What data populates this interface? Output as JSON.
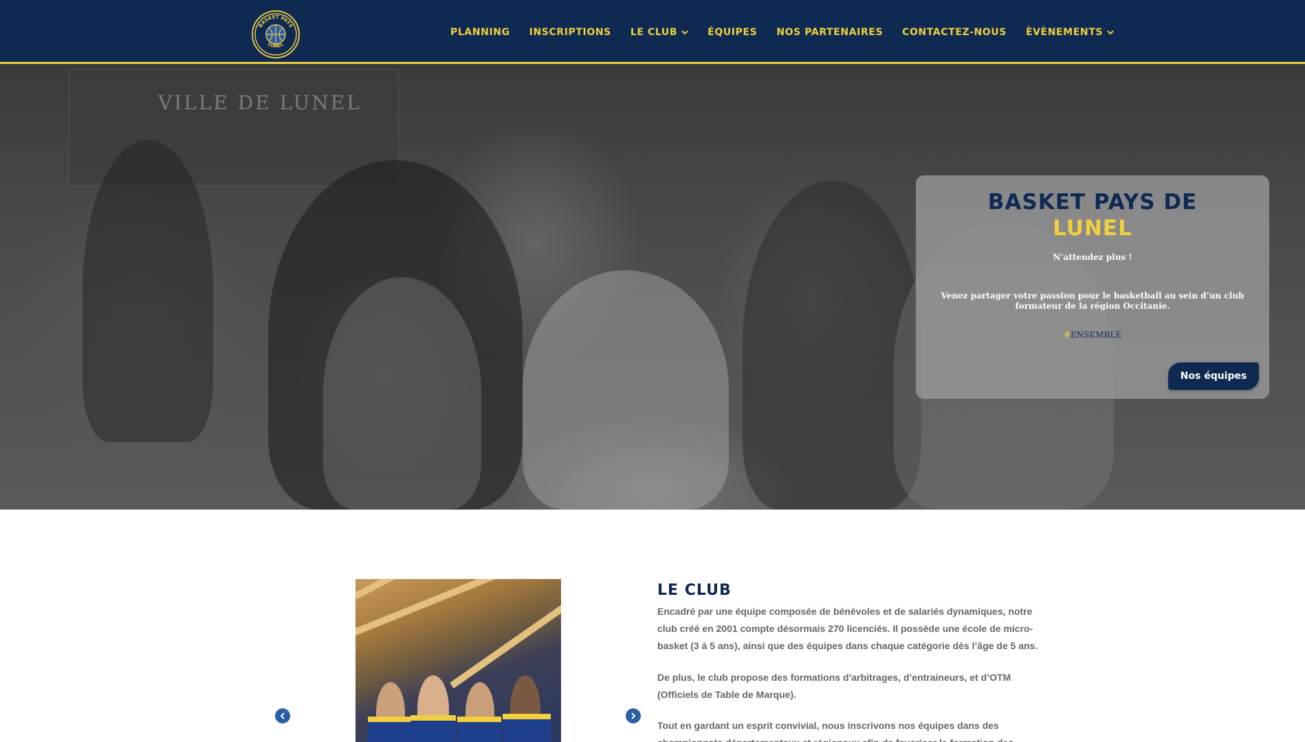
{
  "header": {
    "logo": {
      "icon": "basketball-logo",
      "text_top": "BASKET PAYS",
      "text_bottom": "LUNEL"
    },
    "nav": [
      {
        "label": "PLANNING",
        "dropdown": false
      },
      {
        "label": "INSCRIPTIONS",
        "dropdown": false
      },
      {
        "label": "LE CLUB",
        "dropdown": true
      },
      {
        "label": "ÉQUIPES",
        "dropdown": false
      },
      {
        "label": "NOS PARTENAIRES",
        "dropdown": false
      },
      {
        "label": "CONTACTEZ-NOUS",
        "dropdown": false
      },
      {
        "label": "ÈVÈNEMENTS",
        "dropdown": true
      }
    ]
  },
  "hero": {
    "sign_text": "VILLE DE LUNEL",
    "card": {
      "title_line1": "BASKET PAYS DE",
      "title_line2": "LUNEL",
      "subtitle": "N’attendez plus !",
      "text": "Venez partager votre passion pour le basketball au sein d’un club formateur de la région Occitanie.",
      "tag_hash": "#",
      "tag_word": "ENSEMBLE",
      "button_label": "Nos équipes"
    }
  },
  "club": {
    "title": "LE CLUB",
    "paragraphs": [
      "Encadré par une équipe composée de bénévoles et de salariés dynamiques, notre club créé en 2001 compte désormais 270 licenciés. Il possède une école de micro-basket (3 à 5 ans), ainsi que des équipes dans chaque catégorie dès l’âge de 5 ans.",
      "De plus, le club propose des formations d’arbitrages, d’entraineurs, et d’OTM (Officiels de Table de Marque).",
      "Tout en gardant un esprit convivial, nous inscrivons nos équipes dans des championnats départementaux et régionaux afin de favoriser la formation des jeunes joueurs et"
    ]
  },
  "colors": {
    "navy": "#0e2a52",
    "gold": "#f2cf3e",
    "body_text": "#666666"
  }
}
